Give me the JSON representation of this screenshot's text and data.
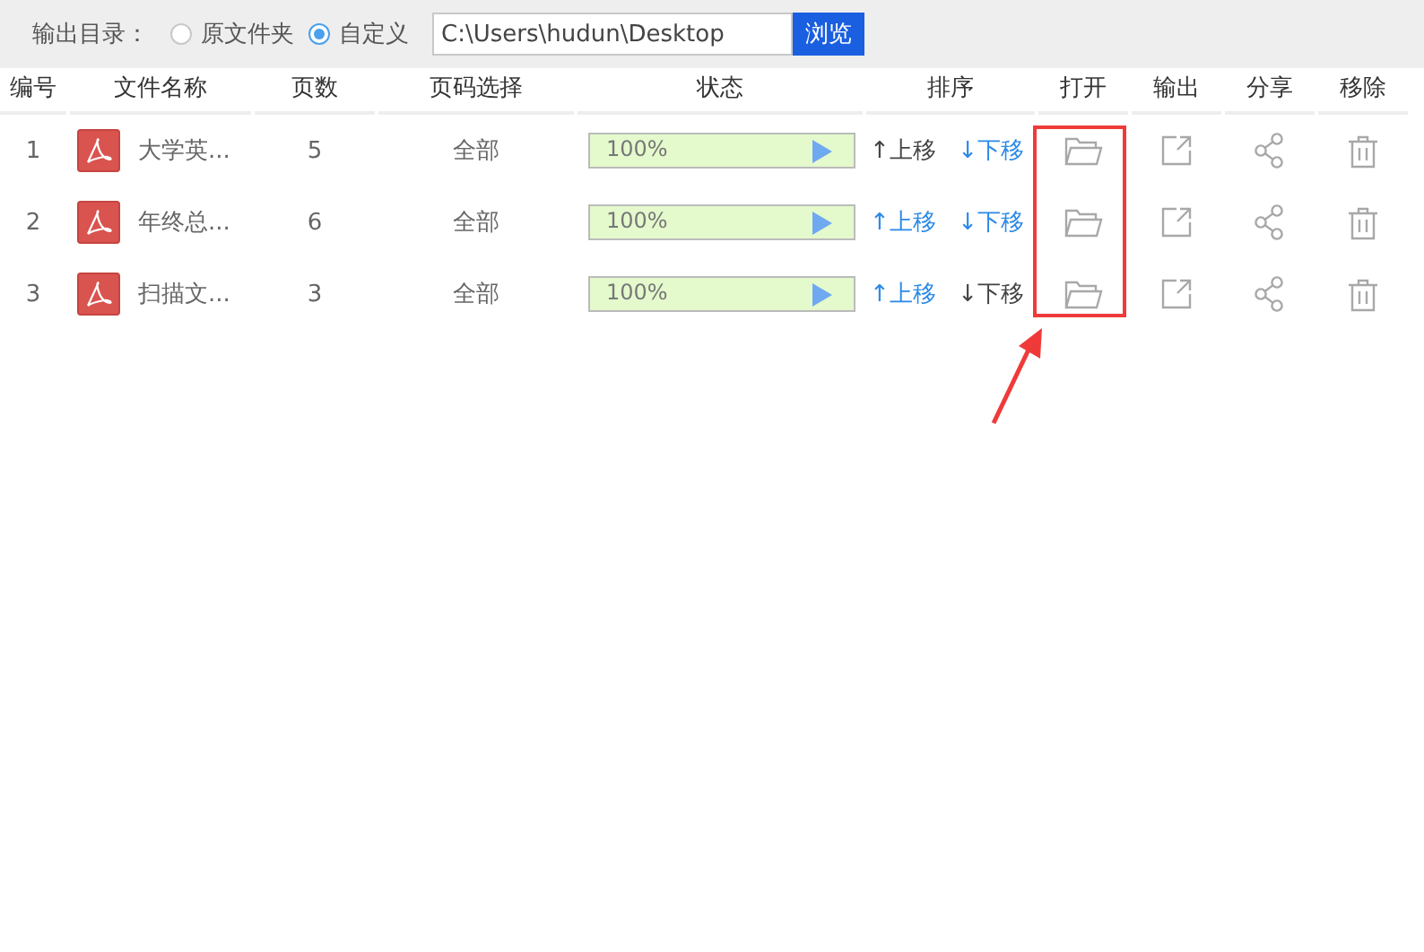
{
  "output_dir": {
    "label": "输出目录：",
    "options": [
      {
        "label": "原文件夹",
        "selected": false
      },
      {
        "label": "自定义",
        "selected": true
      }
    ],
    "path": "C:\\Users\\hudun\\Desktop",
    "browse": "浏览"
  },
  "table": {
    "columns": [
      "编号",
      "文件名称",
      "页数",
      "页码选择",
      "状态",
      "排序",
      "打开",
      "输出",
      "分享",
      "移除"
    ],
    "rows": [
      {
        "number": "1",
        "name": "大学英...",
        "pages": "5",
        "range": "全部",
        "progress": {
          "level": 1,
          "reading": "100%"
        },
        "move_up": {
          "label": "↑上移",
          "disabled": true
        },
        "move_down": {
          "label": "↓下移",
          "disabled": false
        }
      },
      {
        "number": "2",
        "name": "年终总...",
        "pages": "6",
        "range": "全部",
        "progress": {
          "level": 1,
          "reading": "100%"
        },
        "move_up": {
          "label": "↑上移",
          "disabled": false
        },
        "move_down": {
          "label": "↓下移",
          "disabled": false
        }
      },
      {
        "number": "3",
        "name": "扫描文...",
        "pages": "3",
        "range": "全部",
        "progress": {
          "level": 1,
          "reading": "100%"
        },
        "move_up": {
          "label": "↑上移",
          "disabled": false
        },
        "move_down": {
          "label": "↓下移",
          "disabled": true
        }
      }
    ]
  },
  "annotation": {
    "kind": "open-column-callout"
  }
}
